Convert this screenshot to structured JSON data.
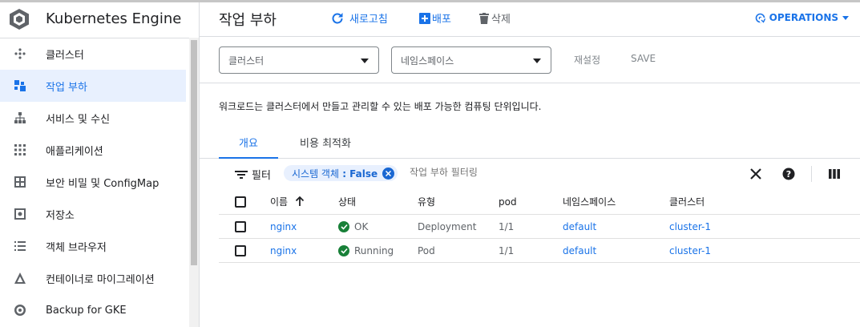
{
  "app": {
    "title": "Kubernetes Engine"
  },
  "sidebar": {
    "items": [
      {
        "label": "클러스터",
        "icon": "clusters-icon"
      },
      {
        "label": "작업 부하",
        "icon": "workloads-icon",
        "active": true
      },
      {
        "label": "서비스 및 수신",
        "icon": "services-icon"
      },
      {
        "label": "애플리케이션",
        "icon": "applications-icon"
      },
      {
        "label": "보안 비밀 및 ConfigMap",
        "icon": "secrets-icon"
      },
      {
        "label": "저장소",
        "icon": "storage-icon"
      },
      {
        "label": "객체 브라우저",
        "icon": "object-browser-icon"
      },
      {
        "label": "컨테이너로 마이그레이션",
        "icon": "migrate-icon"
      },
      {
        "label": "Backup for GKE",
        "icon": "backup-icon"
      }
    ]
  },
  "header": {
    "title": "작업 부하",
    "refresh_label": "새로고침",
    "deploy_label": "배포",
    "delete_label": "삭제",
    "operations_label": "OPERATIONS"
  },
  "filters": {
    "cluster_placeholder": "클러스터",
    "namespace_placeholder": "네임스페이스",
    "reset_label": "재설정",
    "save_label": "SAVE"
  },
  "description": "워크로드는 클러스터에서 만들고 관리할 수 있는 배포 가능한 컴퓨팅 단위입니다.",
  "tabs": [
    {
      "label": "개요",
      "active": true
    },
    {
      "label": "비용 최적화"
    }
  ],
  "table_toolbar": {
    "filter_label": "필터",
    "chip_key": "시스템 객체",
    "chip_sep": " : ",
    "chip_value": "False",
    "filter_placeholder": "작업 부하 필터링"
  },
  "table": {
    "columns": [
      "이름",
      "상태",
      "유형",
      "pod",
      "네임스페이스",
      "클러스터"
    ],
    "rows": [
      {
        "name": "nginx",
        "status": "OK",
        "type": "Deployment",
        "pods": "1/1",
        "namespace": "default",
        "cluster": "cluster-1"
      },
      {
        "name": "nginx",
        "status": "Running",
        "type": "Pod",
        "pods": "1/1",
        "namespace": "default",
        "cluster": "cluster-1"
      }
    ]
  },
  "colors": {
    "accent": "#1a73e8",
    "status_ok": "#188038",
    "active_bg": "#e8f0fe"
  }
}
